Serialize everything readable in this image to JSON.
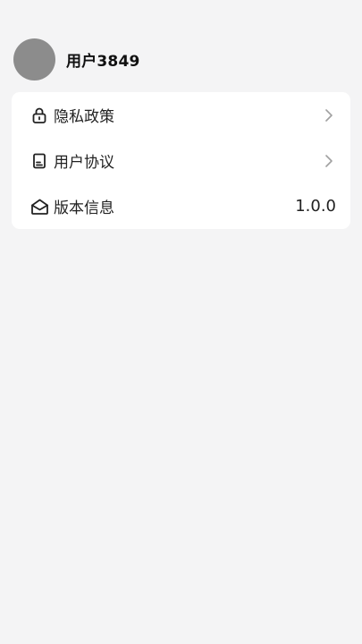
{
  "profile": {
    "username": "用户3849",
    "avatar_color": "#8c8c8c"
  },
  "menu": {
    "items": [
      {
        "label": "隐私政策",
        "icon": "lock-icon",
        "trailing": "chevron-right-icon"
      },
      {
        "label": "用户协议",
        "icon": "document-icon",
        "trailing": "chevron-right-icon"
      },
      {
        "label": "版本信息",
        "icon": "envelope-open-icon",
        "value": "1.0.0"
      }
    ]
  },
  "colors": {
    "background": "#f4f4f5",
    "card": "#ffffff",
    "text": "#222222",
    "chevron": "#a0a0a0"
  }
}
